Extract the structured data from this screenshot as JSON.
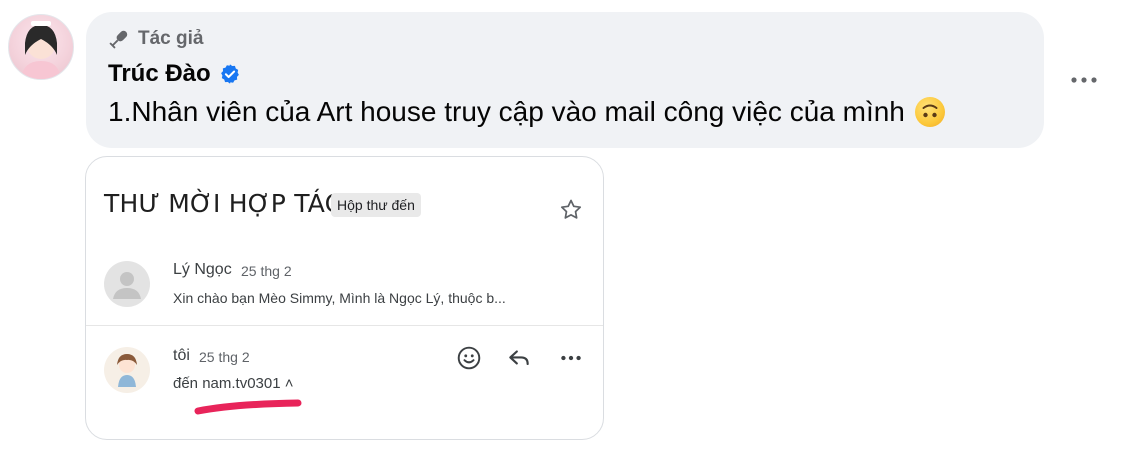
{
  "comment": {
    "author_label": "Tác giả",
    "author_name": "Trúc Đào",
    "verified": true,
    "text": "1.Nhân viên của Art house truy cập vào mail công việc của mình",
    "emoji": "upside-down-face",
    "more_label": "•••"
  },
  "attached_image": {
    "subject": "THƯ MỜI HỢP TÁC",
    "folder_chip": "Hộp thư đến",
    "messages": [
      {
        "sender": "Lý Ngọc",
        "date": "25 thg 2",
        "snippet": "Xin chào bạn Mèo Simmy, Mình là Ngọc Lý, thuộc b..."
      },
      {
        "sender": "tôi",
        "date": "25 thg 2",
        "to_line": "đến nam.tv0301 ˄"
      }
    ],
    "highlight_color": "#e8245a"
  },
  "colors": {
    "bubble_bg": "#f0f2f5",
    "verified_blue": "#1877f2",
    "secondary_text": "#65676b"
  }
}
